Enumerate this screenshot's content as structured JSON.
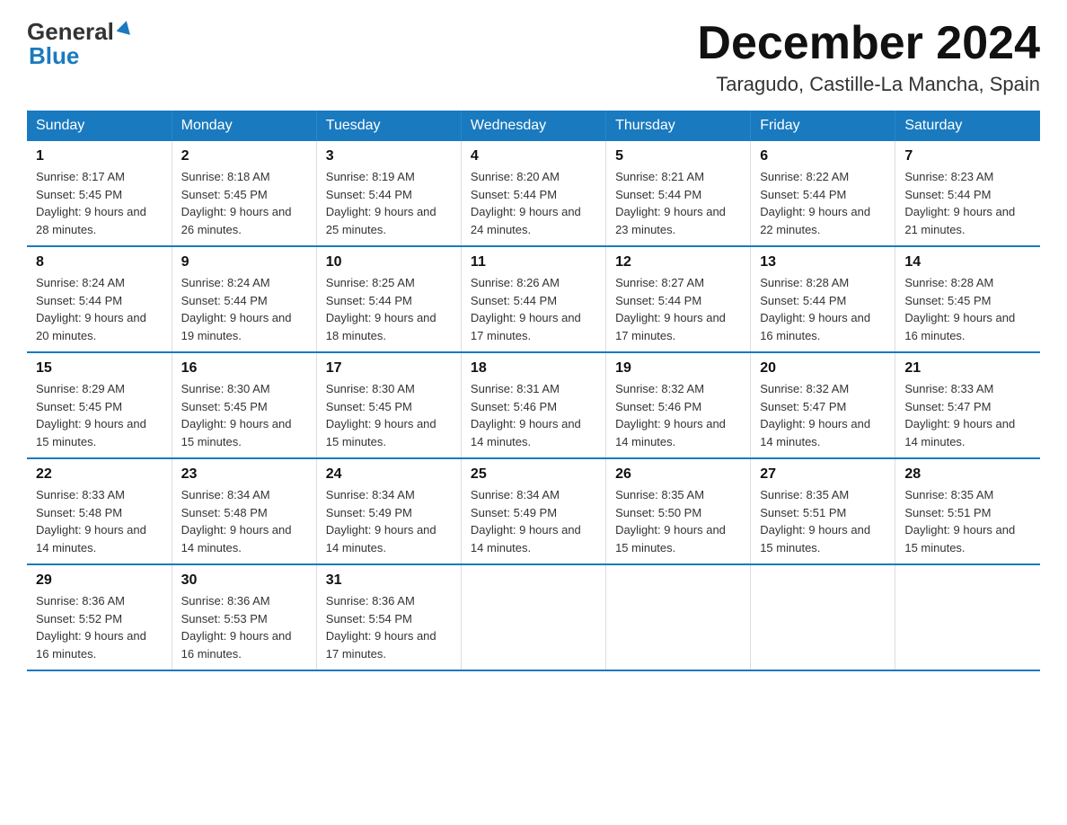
{
  "header": {
    "logo_general": "General",
    "logo_triangle": "▲",
    "logo_blue": "Blue",
    "month_title": "December 2024",
    "location": "Taragudo, Castille-La Mancha, Spain"
  },
  "days_of_week": [
    "Sunday",
    "Monday",
    "Tuesday",
    "Wednesday",
    "Thursday",
    "Friday",
    "Saturday"
  ],
  "weeks": [
    [
      {
        "day": "1",
        "sunrise": "8:17 AM",
        "sunset": "5:45 PM",
        "daylight": "9 hours and 28 minutes."
      },
      {
        "day": "2",
        "sunrise": "8:18 AM",
        "sunset": "5:45 PM",
        "daylight": "9 hours and 26 minutes."
      },
      {
        "day": "3",
        "sunrise": "8:19 AM",
        "sunset": "5:44 PM",
        "daylight": "9 hours and 25 minutes."
      },
      {
        "day": "4",
        "sunrise": "8:20 AM",
        "sunset": "5:44 PM",
        "daylight": "9 hours and 24 minutes."
      },
      {
        "day": "5",
        "sunrise": "8:21 AM",
        "sunset": "5:44 PM",
        "daylight": "9 hours and 23 minutes."
      },
      {
        "day": "6",
        "sunrise": "8:22 AM",
        "sunset": "5:44 PM",
        "daylight": "9 hours and 22 minutes."
      },
      {
        "day": "7",
        "sunrise": "8:23 AM",
        "sunset": "5:44 PM",
        "daylight": "9 hours and 21 minutes."
      }
    ],
    [
      {
        "day": "8",
        "sunrise": "8:24 AM",
        "sunset": "5:44 PM",
        "daylight": "9 hours and 20 minutes."
      },
      {
        "day": "9",
        "sunrise": "8:24 AM",
        "sunset": "5:44 PM",
        "daylight": "9 hours and 19 minutes."
      },
      {
        "day": "10",
        "sunrise": "8:25 AM",
        "sunset": "5:44 PM",
        "daylight": "9 hours and 18 minutes."
      },
      {
        "day": "11",
        "sunrise": "8:26 AM",
        "sunset": "5:44 PM",
        "daylight": "9 hours and 17 minutes."
      },
      {
        "day": "12",
        "sunrise": "8:27 AM",
        "sunset": "5:44 PM",
        "daylight": "9 hours and 17 minutes."
      },
      {
        "day": "13",
        "sunrise": "8:28 AM",
        "sunset": "5:44 PM",
        "daylight": "9 hours and 16 minutes."
      },
      {
        "day": "14",
        "sunrise": "8:28 AM",
        "sunset": "5:45 PM",
        "daylight": "9 hours and 16 minutes."
      }
    ],
    [
      {
        "day": "15",
        "sunrise": "8:29 AM",
        "sunset": "5:45 PM",
        "daylight": "9 hours and 15 minutes."
      },
      {
        "day": "16",
        "sunrise": "8:30 AM",
        "sunset": "5:45 PM",
        "daylight": "9 hours and 15 minutes."
      },
      {
        "day": "17",
        "sunrise": "8:30 AM",
        "sunset": "5:45 PM",
        "daylight": "9 hours and 15 minutes."
      },
      {
        "day": "18",
        "sunrise": "8:31 AM",
        "sunset": "5:46 PM",
        "daylight": "9 hours and 14 minutes."
      },
      {
        "day": "19",
        "sunrise": "8:32 AM",
        "sunset": "5:46 PM",
        "daylight": "9 hours and 14 minutes."
      },
      {
        "day": "20",
        "sunrise": "8:32 AM",
        "sunset": "5:47 PM",
        "daylight": "9 hours and 14 minutes."
      },
      {
        "day": "21",
        "sunrise": "8:33 AM",
        "sunset": "5:47 PM",
        "daylight": "9 hours and 14 minutes."
      }
    ],
    [
      {
        "day": "22",
        "sunrise": "8:33 AM",
        "sunset": "5:48 PM",
        "daylight": "9 hours and 14 minutes."
      },
      {
        "day": "23",
        "sunrise": "8:34 AM",
        "sunset": "5:48 PM",
        "daylight": "9 hours and 14 minutes."
      },
      {
        "day": "24",
        "sunrise": "8:34 AM",
        "sunset": "5:49 PM",
        "daylight": "9 hours and 14 minutes."
      },
      {
        "day": "25",
        "sunrise": "8:34 AM",
        "sunset": "5:49 PM",
        "daylight": "9 hours and 14 minutes."
      },
      {
        "day": "26",
        "sunrise": "8:35 AM",
        "sunset": "5:50 PM",
        "daylight": "9 hours and 15 minutes."
      },
      {
        "day": "27",
        "sunrise": "8:35 AM",
        "sunset": "5:51 PM",
        "daylight": "9 hours and 15 minutes."
      },
      {
        "day": "28",
        "sunrise": "8:35 AM",
        "sunset": "5:51 PM",
        "daylight": "9 hours and 15 minutes."
      }
    ],
    [
      {
        "day": "29",
        "sunrise": "8:36 AM",
        "sunset": "5:52 PM",
        "daylight": "9 hours and 16 minutes."
      },
      {
        "day": "30",
        "sunrise": "8:36 AM",
        "sunset": "5:53 PM",
        "daylight": "9 hours and 16 minutes."
      },
      {
        "day": "31",
        "sunrise": "8:36 AM",
        "sunset": "5:54 PM",
        "daylight": "9 hours and 17 minutes."
      },
      null,
      null,
      null,
      null
    ]
  ]
}
